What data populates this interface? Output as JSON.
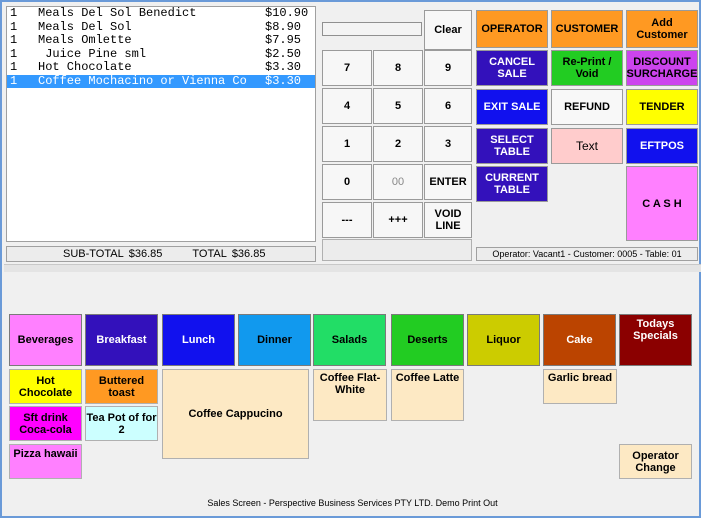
{
  "order": {
    "items": [
      {
        "qty": "1",
        "desc": "Meals Del Sol Benedict",
        "price": "$10.90",
        "selected": false
      },
      {
        "qty": "1",
        "desc": "Meals Del Sol",
        "price": "$8.90",
        "selected": false
      },
      {
        "qty": "1",
        "desc": "Meals Omlette",
        "price": "$7.95",
        "selected": false
      },
      {
        "qty": "1",
        "desc": " Juice Pine sml",
        "price": "$2.50",
        "selected": false
      },
      {
        "qty": "1",
        "desc": "Hot Chocolate",
        "price": "$3.30",
        "selected": false
      },
      {
        "qty": "1",
        "desc": "Coffee Mochacino or Vienna Co",
        "price": "$3.30",
        "selected": true
      }
    ],
    "subtotal_label": "SUB-TOTAL",
    "subtotal_value": "$36.85",
    "total_label": "TOTAL",
    "total_value": "$36.85"
  },
  "keypad": {
    "clear": "Clear",
    "k7": "7",
    "k8": "8",
    "k9": "9",
    "k4": "4",
    "k5": "5",
    "k6": "6",
    "k1": "1",
    "k2": "2",
    "k3": "3",
    "k0": "0",
    "k00": "00",
    "enter": "ENTER",
    "minus": "---",
    "plus": "+++",
    "void_line": "VOID LINE"
  },
  "functions": {
    "operator": "OPERATOR",
    "customer": "CUSTOMER",
    "add_customer": "Add Customer",
    "cancel_sale": "CANCEL SALE",
    "reprint_void": "Re-Print / Void",
    "discount_surcharge": "DISCOUNT SURCHARGE",
    "exit_sale": "EXIT SALE",
    "refund": "REFUND",
    "tender": "TENDER",
    "select_table": "SELECT TABLE",
    "text": "Text",
    "eftpos": "EFTPOS",
    "current_table": "CURRENT TABLE",
    "cash": "C A S H"
  },
  "status": "Operator: Vacant1 - Customer: 0005 - Table: 01",
  "categories": [
    {
      "label": "Beverages",
      "color": "#ff80ff",
      "text": "#000000"
    },
    {
      "label": "Breakfast",
      "color": "#3311bb",
      "text": "#ffffff"
    },
    {
      "label": "Lunch",
      "color": "#1111ee",
      "text": "#ffffff"
    },
    {
      "label": "Dinner",
      "color": "#1199ee",
      "text": "#000000"
    },
    {
      "label": "Salads",
      "color": "#22dd66",
      "text": "#000000"
    },
    {
      "label": "Deserts",
      "color": "#22cc22",
      "text": "#000000"
    },
    {
      "label": "Liquor",
      "color": "#cccc00",
      "text": "#000000"
    },
    {
      "label": "Cake",
      "color": "#bb4400",
      "text": "#ffffff"
    },
    {
      "label": "Todays Specials",
      "color": "#8b0000",
      "text": "#ffffff"
    }
  ],
  "products": {
    "hot_chocolate": "Hot Chocolate",
    "buttered_toast": "Buttered toast",
    "coffee_cappucino": "Coffee Cappucino",
    "coffee_flat_white": "Coffee Flat-White",
    "coffee_latte": "Coffee Latte",
    "garlic_bread": "Garlic bread",
    "sft_drink": "Sft drink Coca-cola",
    "tea_pot": "Tea Pot of  for 2",
    "pizza_hawaii": "Pizza hawaii",
    "operator_change": "Operator Change"
  },
  "footer": "Sales Screen - Perspective Business Services PTY LTD.   Demo Print Out"
}
